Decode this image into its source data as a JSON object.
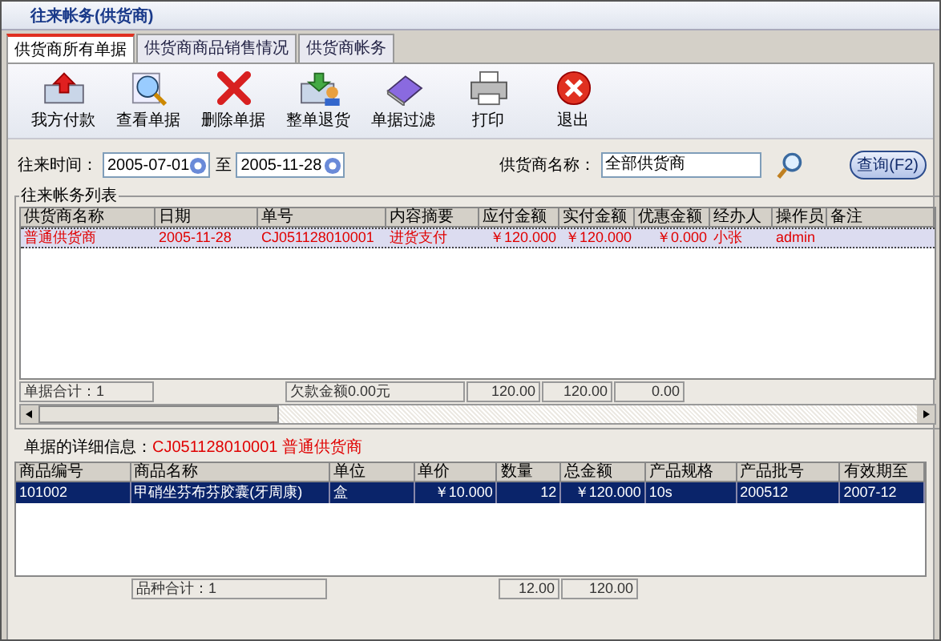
{
  "window": {
    "title": "往来帐务(供货商)"
  },
  "tabs": [
    {
      "label": "供货商所有单据",
      "selected": true
    },
    {
      "label": "供货商商品销售情况",
      "selected": false
    },
    {
      "label": "供货商帐务",
      "selected": false
    }
  ],
  "toolbar": [
    {
      "label": "我方付款",
      "kind": "upload"
    },
    {
      "label": "查看单据",
      "kind": "view"
    },
    {
      "label": "删除单据",
      "kind": "delete"
    },
    {
      "label": "整单退货",
      "kind": "return"
    },
    {
      "label": "单据过滤",
      "kind": "filter"
    },
    {
      "label": "打印",
      "kind": "print"
    },
    {
      "label": "退出",
      "kind": "exit"
    }
  ],
  "filter": {
    "date_label": "往来时间：",
    "date_from": "2005-07-01",
    "to_label": "至",
    "date_to": "2005-11-28",
    "supplier_label": "供货商名称：",
    "supplier_value": "全部供货商",
    "query_button": "查询(F2)"
  },
  "list": {
    "title": "往来帐务列表",
    "columns": [
      "供货商名称",
      "日期",
      "单号",
      "内容摘要",
      "应付金额",
      "实付金额",
      "优惠金额",
      "经办人",
      "操作员",
      "备注"
    ],
    "rows": [
      {
        "selected": true,
        "cells": [
          "普通供货商",
          "2005-11-28",
          "CJ051128010001",
          "进货支付",
          "￥120.000",
          "￥120.000",
          "￥0.000",
          "小张",
          "admin",
          ""
        ]
      }
    ],
    "footer": {
      "count": "单据合计：1",
      "debt": "欠款金额0.00元",
      "payable": "120.00",
      "paid": "120.00",
      "discount": "0.00"
    }
  },
  "detail": {
    "label": "单据的详细信息：",
    "bill_no": "CJ051128010001",
    "supplier": "普通供货商",
    "columns": [
      "商品编号",
      "商品名称",
      "单位",
      "单价",
      "数量",
      "总金额",
      "产品规格",
      "产品批号",
      "有效期至"
    ],
    "rows": [
      {
        "selected": true,
        "cells": [
          "101002",
          "甲硝坐芬布芬胶囊(牙周康)",
          "盒",
          "￥10.000",
          "12",
          "￥120.000",
          "10s",
          "200512",
          "2007-12"
        ]
      }
    ],
    "footer": {
      "count": "品种合计：1",
      "quantity": "12.00",
      "total": "120.00"
    }
  }
}
